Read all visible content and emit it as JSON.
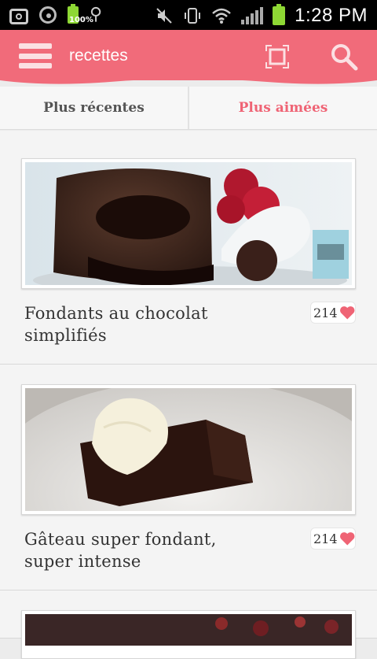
{
  "status_bar": {
    "battery_small_percent": "100%",
    "time": "1:28 PM",
    "icons": [
      "camera-icon",
      "record-icon",
      "battery-icon",
      "usb-icon",
      "mute-icon",
      "vibrate-icon",
      "wifi-icon",
      "signal-icon",
      "battery-icon"
    ]
  },
  "app_bar": {
    "title": "recettes",
    "menu_icon": "hamburger-icon",
    "actions": [
      "fullscreen-icon",
      "search-icon"
    ],
    "color": "#f16b7a"
  },
  "tabs": [
    {
      "label": "Plus récentes",
      "selected": false
    },
    {
      "label": "Plus aimées",
      "selected": true
    }
  ],
  "recipes": [
    {
      "title_line1": "Fondants au chocolat",
      "title_line2": "simplifiés",
      "likes": "214"
    },
    {
      "title_line1": "Gâteau super fondant,",
      "title_line2": "super intense",
      "likes": "214"
    }
  ],
  "colors": {
    "accent": "#ef6475",
    "heart": "#ef6475",
    "tab_text": "#555555"
  }
}
